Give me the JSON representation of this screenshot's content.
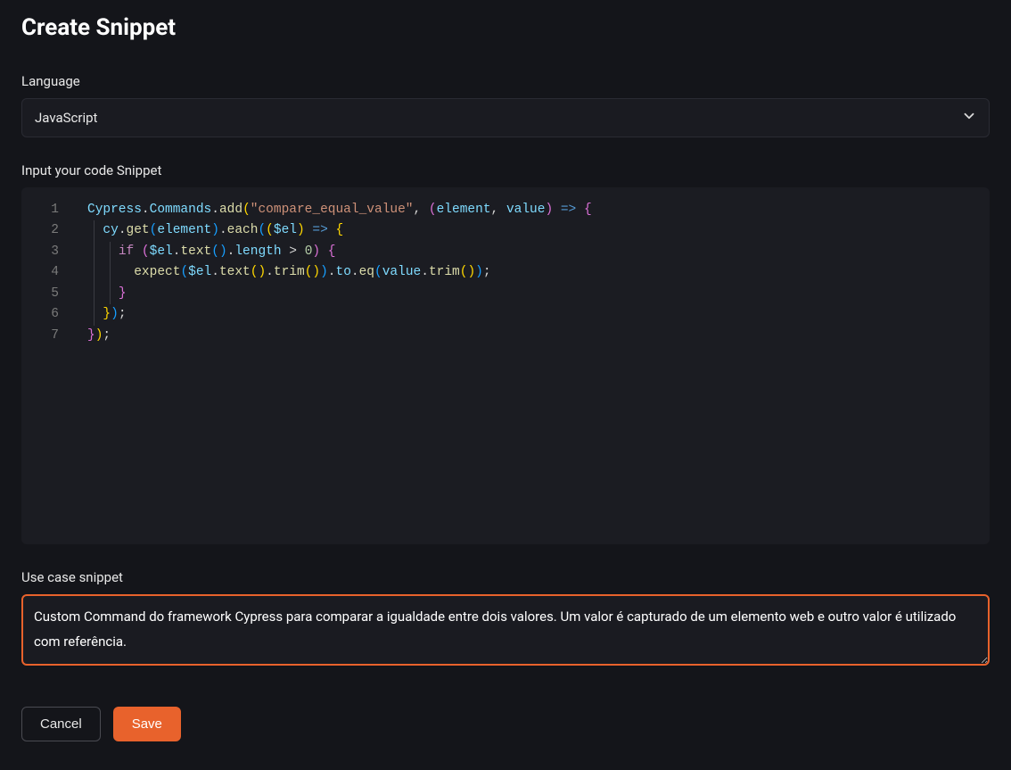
{
  "page": {
    "title": "Create Snippet"
  },
  "fields": {
    "language_label": "Language",
    "language_value": "JavaScript",
    "code_label": "Input your code Snippet",
    "usecase_label": "Use case snippet",
    "usecase_value": "Custom Command do framework Cypress para comparar a igualdade entre dois valores. Um valor é capturado de um elemento web e outro valor é utilizado com referência."
  },
  "code": {
    "lines": [
      1,
      2,
      3,
      4,
      5,
      6,
      7
    ],
    "raw": "Cypress.Commands.add(\"compare_equal_value\", (element, value) => {\n  cy.get(element).each(($el) => {\n    if ($el.text().length > 0) {\n      expect($el.text().trim()).to.eq(value.trim());\n    }\n  });\n});",
    "tokens": [
      [
        [
          "Cypress",
          "ident"
        ],
        [
          ".",
          "punc"
        ],
        [
          "Commands",
          "ident"
        ],
        [
          ".",
          "punc"
        ],
        [
          "add",
          "method"
        ],
        [
          "(",
          "brace"
        ],
        [
          "\"compare_equal_value\"",
          "string"
        ],
        [
          ", ",
          "punc"
        ],
        [
          "(",
          "brace2"
        ],
        [
          "element",
          "ident"
        ],
        [
          ", ",
          "punc"
        ],
        [
          "value",
          "ident"
        ],
        [
          ")",
          "brace2"
        ],
        [
          " ",
          "default"
        ],
        [
          "=>",
          "arrow"
        ],
        [
          " ",
          "default"
        ],
        [
          "{",
          "brace2"
        ]
      ],
      [
        [
          "  ",
          "default"
        ],
        [
          "cy",
          "ident"
        ],
        [
          ".",
          "punc"
        ],
        [
          "get",
          "method"
        ],
        [
          "(",
          "brace3"
        ],
        [
          "element",
          "ident"
        ],
        [
          ")",
          "brace3"
        ],
        [
          ".",
          "punc"
        ],
        [
          "each",
          "method"
        ],
        [
          "(",
          "brace3"
        ],
        [
          "(",
          "brace"
        ],
        [
          "$el",
          "ident"
        ],
        [
          ")",
          "brace"
        ],
        [
          " ",
          "default"
        ],
        [
          "=>",
          "arrow"
        ],
        [
          " ",
          "default"
        ],
        [
          "{",
          "brace"
        ]
      ],
      [
        [
          "    ",
          "default"
        ],
        [
          "if",
          "keyword"
        ],
        [
          " ",
          "default"
        ],
        [
          "(",
          "brace2"
        ],
        [
          "$el",
          "ident"
        ],
        [
          ".",
          "punc"
        ],
        [
          "text",
          "method"
        ],
        [
          "(",
          "brace3"
        ],
        [
          ")",
          "brace3"
        ],
        [
          ".",
          "punc"
        ],
        [
          "length",
          "ident"
        ],
        [
          " > ",
          "punc"
        ],
        [
          "0",
          "num"
        ],
        [
          ")",
          "brace2"
        ],
        [
          " ",
          "default"
        ],
        [
          "{",
          "brace2"
        ]
      ],
      [
        [
          "      ",
          "default"
        ],
        [
          "expect",
          "method"
        ],
        [
          "(",
          "brace3"
        ],
        [
          "$el",
          "ident"
        ],
        [
          ".",
          "punc"
        ],
        [
          "text",
          "method"
        ],
        [
          "(",
          "brace"
        ],
        [
          ")",
          "brace"
        ],
        [
          ".",
          "punc"
        ],
        [
          "trim",
          "method"
        ],
        [
          "(",
          "brace"
        ],
        [
          ")",
          "brace"
        ],
        [
          ")",
          "brace3"
        ],
        [
          ".",
          "punc"
        ],
        [
          "to",
          "ident"
        ],
        [
          ".",
          "punc"
        ],
        [
          "eq",
          "method"
        ],
        [
          "(",
          "brace3"
        ],
        [
          "value",
          "ident"
        ],
        [
          ".",
          "punc"
        ],
        [
          "trim",
          "method"
        ],
        [
          "(",
          "brace"
        ],
        [
          ")",
          "brace"
        ],
        [
          ")",
          "brace3"
        ],
        [
          ";",
          "punc"
        ]
      ],
      [
        [
          "    ",
          "default"
        ],
        [
          "}",
          "brace2"
        ]
      ],
      [
        [
          "  ",
          "default"
        ],
        [
          "}",
          "brace"
        ],
        [
          ")",
          "brace3"
        ],
        [
          ";",
          "punc"
        ]
      ],
      [
        [
          "}",
          "brace2"
        ],
        [
          ")",
          "brace"
        ],
        [
          ";",
          "punc"
        ]
      ]
    ]
  },
  "buttons": {
    "cancel": "Cancel",
    "save": "Save"
  }
}
